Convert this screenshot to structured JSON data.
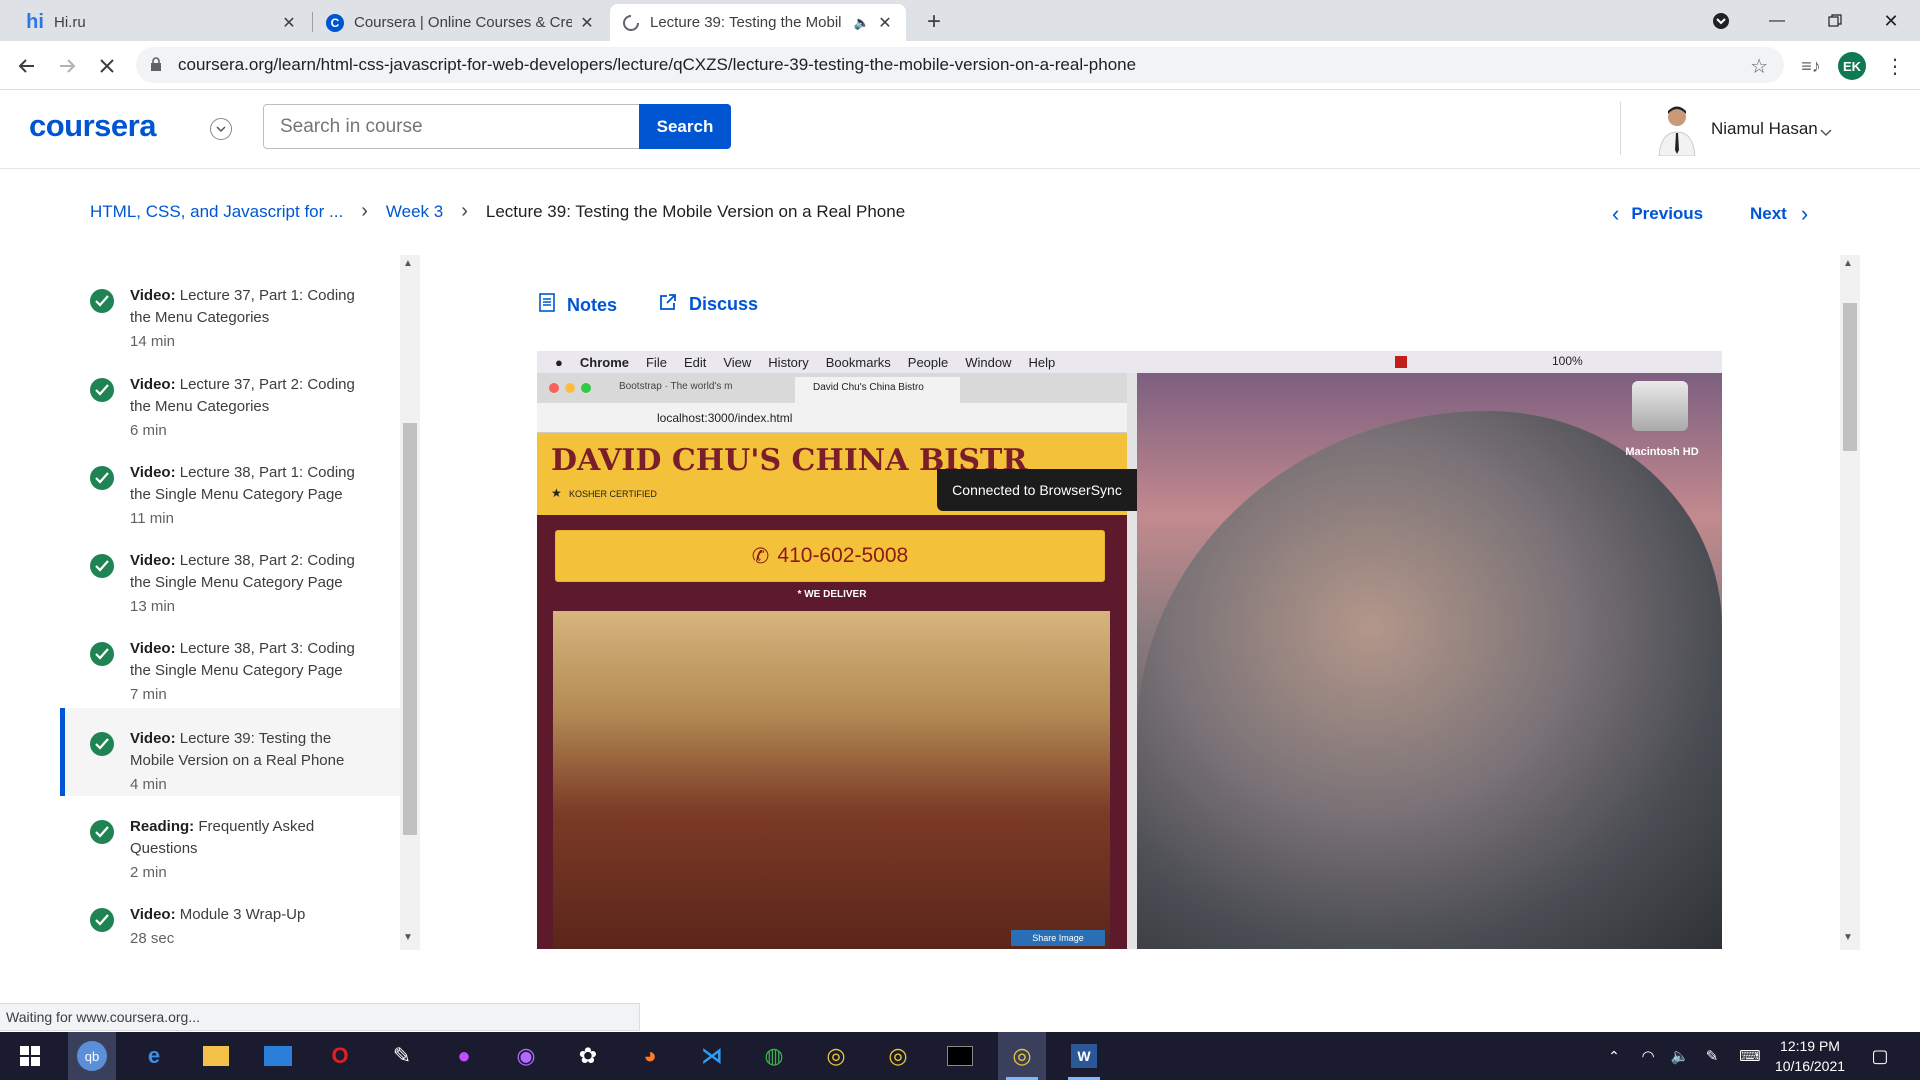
{
  "browser": {
    "tabs": [
      {
        "title": "Hi.ru",
        "favicon": "hi",
        "active": false
      },
      {
        "title": "Coursera | Online Courses & Cre",
        "favicon": "C",
        "active": false
      },
      {
        "title": "Lecture 39: Testing the Mobil",
        "favicon": "spinner",
        "active": true
      }
    ],
    "url": "coursera.org/learn/html-css-javascript-for-web-developers/lecture/qCXZS/lecture-39-testing-the-mobile-version-on-a-real-phone",
    "profile_initials": "EK",
    "status_text": "Waiting for www.coursera.org..."
  },
  "header": {
    "logo": "coursera",
    "search_placeholder": "Search in course",
    "search_button": "Search",
    "user_name": "Niamul Hasan"
  },
  "breadcrumb": {
    "course": "HTML, CSS, and Javascript for ...",
    "week": "Week 3",
    "current": "Lecture 39: Testing the Mobile Version on a Real Phone"
  },
  "pager": {
    "previous": "Previous",
    "next": "Next"
  },
  "sidebar": {
    "items": [
      {
        "type": "Video:",
        "title": "Lecture 37, Part 1: Coding the Menu Categories",
        "duration": "14 min"
      },
      {
        "type": "Video:",
        "title": "Lecture 37, Part 2: Coding the Menu Categories",
        "duration": "6 min"
      },
      {
        "type": "Video:",
        "title": "Lecture 38, Part 1: Coding the Single Menu Category Page",
        "duration": "11 min"
      },
      {
        "type": "Video:",
        "title": "Lecture 38, Part 2: Coding the Single Menu Category Page",
        "duration": "13 min"
      },
      {
        "type": "Video:",
        "title": "Lecture 38, Part 3: Coding the Single Menu Category Page",
        "duration": "7 min"
      },
      {
        "type": "Video:",
        "title": "Lecture 39: Testing the Mobile Version on a Real Phone",
        "duration": "4 min"
      },
      {
        "type": "Reading:",
        "title": "Frequently Asked Questions",
        "duration": "2 min"
      },
      {
        "type": "Video:",
        "title": "Module 3 Wrap-Up",
        "duration": "28 sec"
      }
    ]
  },
  "tools": {
    "notes": "Notes",
    "discuss": "Discuss"
  },
  "video_frame": {
    "menubar": [
      "Chrome",
      "File",
      "Edit",
      "View",
      "History",
      "Bookmarks",
      "People",
      "Window",
      "Help"
    ],
    "battery": "100%",
    "inner_tabs": [
      "Bootstrap · The world's m",
      "David Chu's China Bistro"
    ],
    "inner_url": "localhost:3000/index.html",
    "site_title": "DAVID CHU'S CHINA BISTR",
    "kosher": "KOSHER CERTIFIED",
    "phone": "410-602-5008",
    "deliver": "* WE DELIVER",
    "browsersync": "Connected to BrowserSync",
    "share_image": "Share Image",
    "drive_label": "Macintosh HD"
  },
  "taskbar": {
    "time": "12:19 PM",
    "date": "10/16/2021"
  },
  "colors": {
    "brand": "#0056d2",
    "check": "#1f8354",
    "taskbar": "#1b1b2f"
  }
}
